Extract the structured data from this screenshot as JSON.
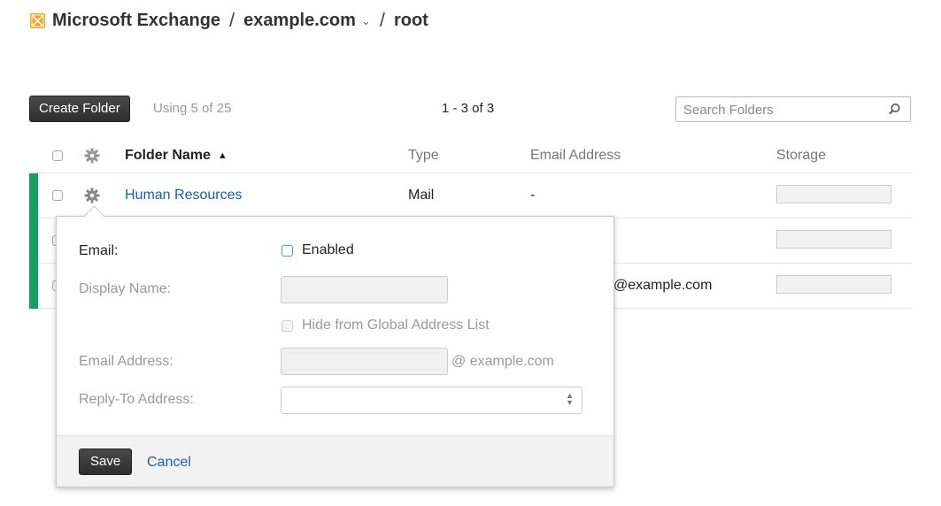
{
  "header": {
    "app_name": "Microsoft Exchange",
    "separator": "/",
    "domain": "example.com",
    "folder": "root"
  },
  "toolbar": {
    "create_label": "Create Folder",
    "usage": "Using 5 of 25",
    "pager": "1 - 3 of 3",
    "search_placeholder": "Search Folders"
  },
  "table": {
    "columns": {
      "name": "Folder Name",
      "type": "Type",
      "email": "Email Address",
      "storage": "Storage"
    },
    "rows": [
      {
        "name": "Human Resources",
        "type": "Mail",
        "email": "-"
      },
      {
        "name": "",
        "type": "",
        "email": ""
      },
      {
        "name": "",
        "type": "",
        "email": "@example.com"
      }
    ]
  },
  "popover": {
    "email_label": "Email:",
    "enabled_label": "Enabled",
    "display_name_label": "Display Name:",
    "hide_gal_label": "Hide from Global Address List",
    "email_address_label": "Email Address:",
    "domain_suffix": "@ example.com",
    "reply_to_label": "Reply-To Address:",
    "save_label": "Save",
    "cancel_label": "Cancel"
  },
  "colors": {
    "accent_green": "#12a15e",
    "link_blue": "#1b5fa8",
    "logo_orange": "#f7a324"
  }
}
